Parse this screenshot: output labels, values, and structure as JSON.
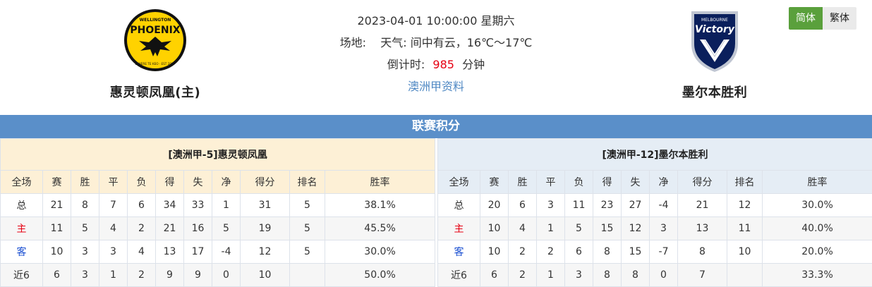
{
  "header": {
    "home_team": {
      "name": "惠灵顿凤凰(主)",
      "logo_text_top": "WELLINGTON",
      "logo_text_main": "PHOENIX",
      "logo_text_bottom": "E WERE TE KEO · EST 2007",
      "logo_colors": {
        "primary": "#ffd200",
        "secondary": "#111111"
      }
    },
    "away_team": {
      "name": "墨尔本胜利",
      "logo_text_top": "MELBOURNE",
      "logo_text_main": "Victory",
      "logo_colors": {
        "primary": "#0a1f5c",
        "secondary": "#c0c6d2"
      }
    },
    "datetime": "2023-04-01 10:00:00 星期六",
    "venue_label": "场地:",
    "weather_label": "天气:",
    "weather_value": "间中有云，16℃～17℃",
    "countdown_label": "倒计时:",
    "countdown_value": "985",
    "countdown_unit": "分钟",
    "league_link": "澳洲甲资料"
  },
  "lang_switch": {
    "simplified": "简体",
    "traditional": "繁体"
  },
  "section_title": "联赛积分",
  "standings": {
    "columns": [
      "全场",
      "赛",
      "胜",
      "平",
      "负",
      "得",
      "失",
      "净",
      "得分",
      "排名",
      "胜率"
    ],
    "home": {
      "caption": "[澳洲甲-5]惠灵顿凤凰",
      "rows": [
        {
          "label": "总",
          "type": "total",
          "cells": [
            "21",
            "8",
            "7",
            "6",
            "34",
            "33",
            "1",
            "31",
            "5",
            "38.1%"
          ]
        },
        {
          "label": "主",
          "type": "home",
          "cells": [
            "11",
            "5",
            "4",
            "2",
            "21",
            "16",
            "5",
            "19",
            "5",
            "45.5%"
          ]
        },
        {
          "label": "客",
          "type": "away",
          "cells": [
            "10",
            "3",
            "3",
            "4",
            "13",
            "17",
            "-4",
            "12",
            "5",
            "30.0%"
          ]
        },
        {
          "label": "近6",
          "type": "recent",
          "cells": [
            "6",
            "3",
            "1",
            "2",
            "9",
            "9",
            "0",
            "10",
            "",
            "50.0%"
          ]
        }
      ]
    },
    "away": {
      "caption": "[澳洲甲-12]墨尔本胜利",
      "rows": [
        {
          "label": "总",
          "type": "total",
          "cells": [
            "20",
            "6",
            "3",
            "11",
            "23",
            "27",
            "-4",
            "21",
            "12",
            "30.0%"
          ]
        },
        {
          "label": "主",
          "type": "home",
          "cells": [
            "10",
            "4",
            "1",
            "5",
            "15",
            "12",
            "3",
            "13",
            "11",
            "40.0%"
          ]
        },
        {
          "label": "客",
          "type": "away",
          "cells": [
            "10",
            "2",
            "2",
            "6",
            "8",
            "15",
            "-7",
            "8",
            "10",
            "20.0%"
          ]
        },
        {
          "label": "近6",
          "type": "recent",
          "cells": [
            "6",
            "2",
            "1",
            "3",
            "8",
            "8",
            "0",
            "7",
            "",
            "33.3%"
          ]
        }
      ]
    }
  },
  "colors": {
    "section_bar": "#5a8fc9",
    "home_header_bg": "#fdf0d6",
    "away_header_bg": "#e5edf5",
    "countdown_red": "#e60012",
    "link_blue": "#4f88c3",
    "lang_active": "#5aa03c"
  }
}
